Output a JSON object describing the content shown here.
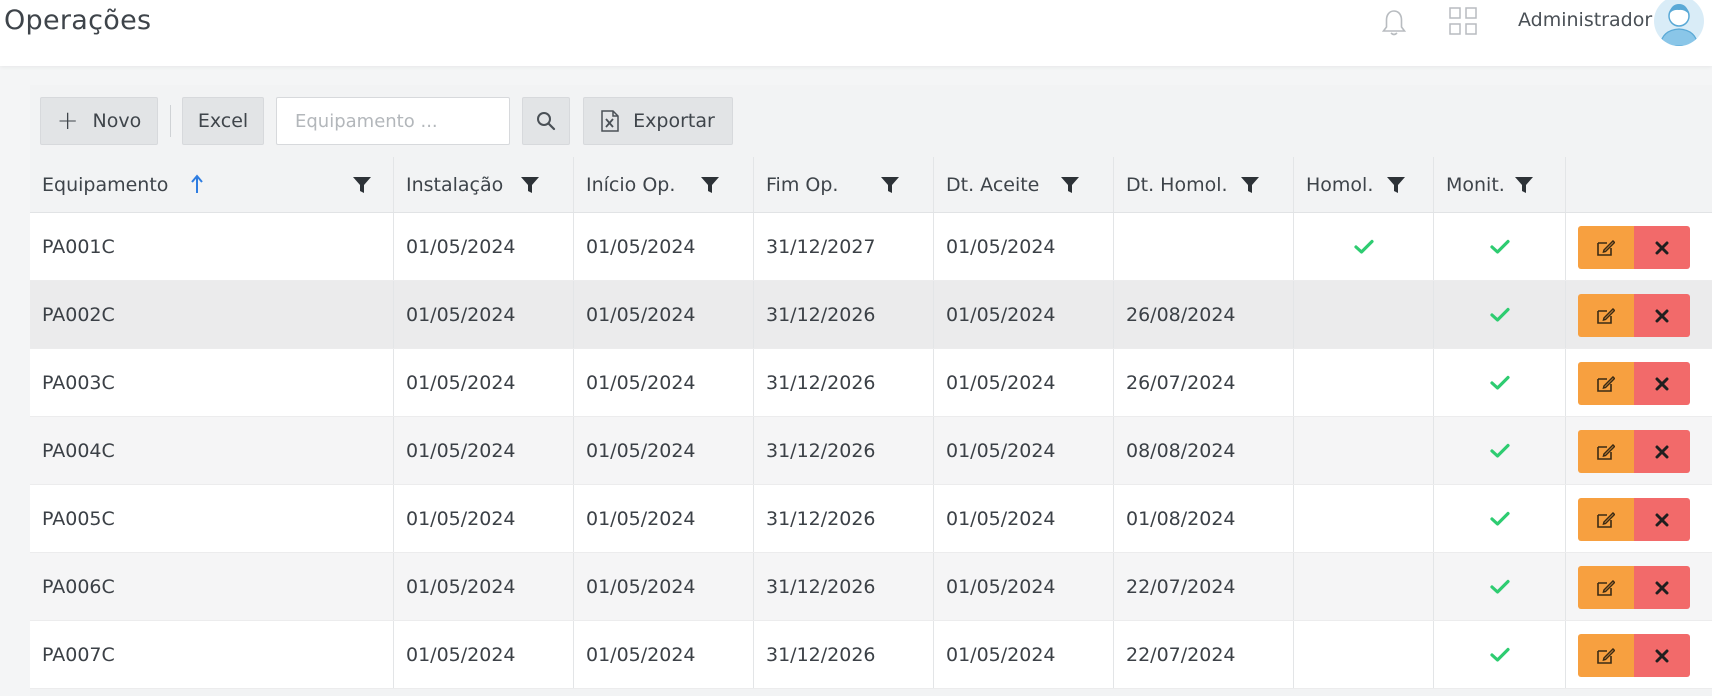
{
  "header": {
    "title": "Operações",
    "username": "Administrador",
    "icons": [
      "bell-icon",
      "apps-grid-icon",
      "user-avatar"
    ]
  },
  "toolbar": {
    "novo_label": "Novo",
    "excel_label": "Excel",
    "search_placeholder": "Equipamento ...",
    "search_value": "",
    "export_label": "Exportar"
  },
  "table": {
    "columns": [
      "Equipamento",
      "Instalação",
      "Início Op.",
      "Fim Op.",
      "Dt. Aceite",
      "Dt. Homol.",
      "Homol.",
      "Monit."
    ],
    "sort": {
      "column": "Equipamento",
      "direction": "ascending"
    },
    "rows": [
      {
        "equipamento": "PA001C",
        "instalacao": "01/05/2024",
        "inicio": "01/05/2024",
        "fim": "31/12/2027",
        "aceite": "01/05/2024",
        "homol_date": "",
        "homol": true,
        "monit": true
      },
      {
        "equipamento": "PA002C",
        "instalacao": "01/05/2024",
        "inicio": "01/05/2024",
        "fim": "31/12/2026",
        "aceite": "01/05/2024",
        "homol_date": "26/08/2024",
        "homol": false,
        "monit": true
      },
      {
        "equipamento": "PA003C",
        "instalacao": "01/05/2024",
        "inicio": "01/05/2024",
        "fim": "31/12/2026",
        "aceite": "01/05/2024",
        "homol_date": "26/07/2024",
        "homol": false,
        "monit": true
      },
      {
        "equipamento": "PA004C",
        "instalacao": "01/05/2024",
        "inicio": "01/05/2024",
        "fim": "31/12/2026",
        "aceite": "01/05/2024",
        "homol_date": "08/08/2024",
        "homol": false,
        "monit": true
      },
      {
        "equipamento": "PA005C",
        "instalacao": "01/05/2024",
        "inicio": "01/05/2024",
        "fim": "31/12/2026",
        "aceite": "01/05/2024",
        "homol_date": "01/08/2024",
        "homol": false,
        "monit": true
      },
      {
        "equipamento": "PA006C",
        "instalacao": "01/05/2024",
        "inicio": "01/05/2024",
        "fim": "31/12/2026",
        "aceite": "01/05/2024",
        "homol_date": "22/07/2024",
        "homol": false,
        "monit": true
      },
      {
        "equipamento": "PA007C",
        "instalacao": "01/05/2024",
        "inicio": "01/05/2024",
        "fim": "31/12/2026",
        "aceite": "01/05/2024",
        "homol_date": "22/07/2024",
        "homol": false,
        "monit": true
      }
    ]
  },
  "colors": {
    "check": "#2ecc71",
    "edit_button": "#f7a040",
    "delete_button": "#f26a6a",
    "sort_arrow": "#2f7de1"
  }
}
